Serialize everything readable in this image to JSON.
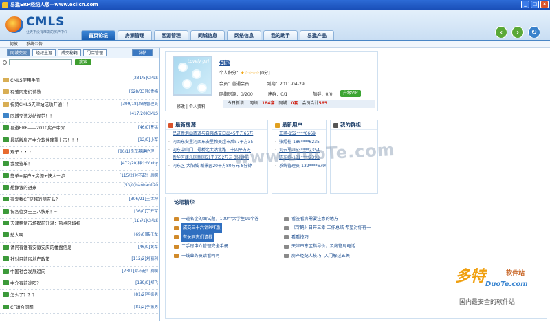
{
  "window": {
    "title": "易遨ERP经纪人版—www.ecllcn.com"
  },
  "logo": {
    "brand": "CMLS",
    "slogan": "让天下没有难做的房产中介"
  },
  "nav": {
    "tabs": [
      "首页论坛",
      "房源管理",
      "客源管理",
      "同城信息",
      "网络信息",
      "我的助手",
      "易遨产品"
    ]
  },
  "notice": {
    "user": "何敏",
    "label": "系统公告："
  },
  "left": {
    "tabs": [
      "同城交流",
      "经纪生涯",
      "成交秘籍",
      "门店管理"
    ],
    "publish": "发帖",
    "search_button": "搜索",
    "posts": [
      {
        "icon": "image-icon",
        "title": "CMLS使用手册",
        "meta": "[281/5]CMLS"
      },
      {
        "icon": "image-icon",
        "title": "有差同志们请教",
        "meta": "[628/33]张雪梅"
      },
      {
        "icon": "image-icon",
        "title": "祝贺CMLS天津站成功开通！！",
        "meta": "[399/18]系统管理员"
      },
      {
        "icon": "book-icon",
        "title": "同城交流发帖规范！！",
        "meta": "[417/20]CMLS"
      },
      {
        "icon": "green-icon",
        "title": "易遨ERP——2010房产中介",
        "meta": "[46/0]曹猛"
      },
      {
        "icon": "green-icon",
        "title": "最新版房产中介软件隆重上市！！！",
        "meta": "[12/0]小军"
      },
      {
        "icon": "star-icon",
        "title": "观子・・・",
        "meta": "[80/1]良茂基建护理！"
      },
      {
        "icon": "green-icon",
        "title": "我要签单！",
        "meta": "[472/20]稀个/V×by"
      },
      {
        "icon": "green-icon",
        "title": "签单=客户+房源+快人一步",
        "meta": "[115/2]对不起！刷啊"
      },
      {
        "icon": "green-icon",
        "title": "想挣钱的进来",
        "meta": "[53/0]hanhan120"
      },
      {
        "icon": "green-icon",
        "title": "有爱我CF穿越的朋友么？",
        "meta": "[306/21]王世坤"
      },
      {
        "icon": "green-icon",
        "title": "祝各位女士三八快乐！～",
        "meta": "[36/0]丁开军"
      },
      {
        "icon": "green-icon",
        "title": "天津租赁市场提前升温：热点区域抢",
        "meta": "[115/1]CMLS"
      },
      {
        "icon": "green-icon",
        "title": "愁人啊",
        "meta": "[69/0]韩玉龙"
      },
      {
        "icon": "green-icon",
        "title": "请问有谁有安徽安庆的楼盘信息",
        "meta": "[46/0]黄军"
      },
      {
        "icon": "green-icon",
        "title": "针对目前房地产政策",
        "meta": "[112/2]刘丽利"
      },
      {
        "icon": "green-icon",
        "title": "中国社会发展趋向",
        "meta": "[73/1]对不起！刷啊"
      },
      {
        "icon": "green-icon",
        "title": "中介有前途吗？",
        "meta": "[139/0]郑飞"
      },
      {
        "icon": "green-icon",
        "title": "怎么了？？？",
        "meta": "[81/2]李振男"
      },
      {
        "icon": "green-icon",
        "title": "CF请合同图",
        "meta": "[81/2]李振男"
      }
    ]
  },
  "profile": {
    "name": "何敏",
    "points_label": "个人积分：",
    "points_value": "[0分]",
    "member_label": "会员：普通会员",
    "expire": "到期：2011-04-29",
    "net_listing": "网络房源：0/200",
    "build": "建群：0/1",
    "friends": "加群：0/0",
    "vip_button": "升级VIP",
    "links": "修改 | 个人资料",
    "today": "今日新增",
    "web_label": "网络：",
    "web_value": "184套",
    "city_label": "同城：",
    "city_value": "0套",
    "members_label": "会员合计",
    "members_value": "565",
    "avatar_caption": "Lovely girl"
  },
  "latest_listings": {
    "title": "最新房源",
    "items": [
      "民进新港山西道与自强路交口出45平方65万",
      "河西东安里河西东安里物美超市后57平方35",
      "河东中山门二号桥北大沽北路二十四平方万",
      "新华区康乐园新园51平方52万元 3分钟前",
      "河东区-大阳城-新景园20平方80万元 8分钟"
    ]
  },
  "latest_users": {
    "title": "最新用户",
    "items": [
      "王甫-152****0669",
      "张煜桂-186****6235",
      "刘云军-153****2354",
      "陈东岭-131****2393",
      "系统管理员-132****6799"
    ]
  },
  "my_group": {
    "title": "我的群组"
  },
  "forum": {
    "title": "论坛精华",
    "left": [
      {
        "text": "一道名企的面试题，100个大学生99个答",
        "highlight": false
      },
      {
        "text": "成交三十六计PPT版",
        "highlight": true
      },
      {
        "text": "有关同志们请教",
        "highlight": true
      },
      {
        "text": "二手房中介管理完全手册",
        "highlight": false
      },
      {
        "text": "一线业务员请看呵呵",
        "highlight": false
      }
    ],
    "right": [
      "看签看房需要注意的地方",
      "《寺鹤》日开三幸 工作总结 希望对你有一",
      "看看技巧",
      "天津市东区指导价，及房管局电话",
      "房产经纪人技巧--入门解过五关"
    ]
  },
  "watermark": {
    "center": "www.DuoTe.com",
    "logo": "多特",
    "logo_tag": "软件站",
    "site": "DuoTe.com",
    "slogan": "国内最安全的软件站"
  },
  "colors": {
    "accent": "#1b5fb2",
    "header_bg": "#d8e8f7",
    "green": "#3ca533"
  }
}
